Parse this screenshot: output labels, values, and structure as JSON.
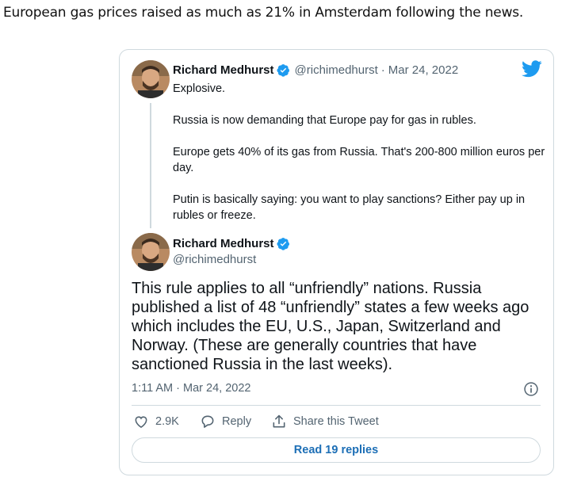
{
  "intro_text": "European gas prices raised as much as 21% in Amsterdam following the news.",
  "colors": {
    "accent": "#1d9bf0",
    "muted": "#536471",
    "border": "#cfd9de",
    "link": "#1d6fb6"
  },
  "quoted_tweet": {
    "author_name": "Richard Medhurst",
    "handle": "@richimedhurst",
    "separator": "·",
    "date": "Mar 24, 2022",
    "paragraphs": [
      "Explosive.",
      "Russia is now demanding that Europe pay for gas in rubles.",
      "Europe gets 40% of its gas from Russia. That's 200-800 million euros per day.",
      "Putin is basically saying: you want to play sanctions? Either pay up in rubles or freeze."
    ]
  },
  "main_tweet": {
    "author_name": "Richard Medhurst",
    "handle": "@richimedhurst",
    "text": "This rule applies to all “unfriendly” nations. Russia published a list of 48 “unfriendly” states a few weeks ago which includes the EU, U.S., Japan, Switzerland and Norway. (These are generally countries that have sanctioned Russia in the last weeks).",
    "timestamp": "1:11 AM · Mar 24, 2022"
  },
  "actions": {
    "like_count": "2.9K",
    "reply_label": "Reply",
    "share_label": "Share this Tweet"
  },
  "read_replies_label": "Read 19 replies",
  "icons": [
    "twitter-bird-icon",
    "verified-badge-icon",
    "info-icon",
    "heart-icon",
    "reply-bubble-icon",
    "share-icon"
  ]
}
